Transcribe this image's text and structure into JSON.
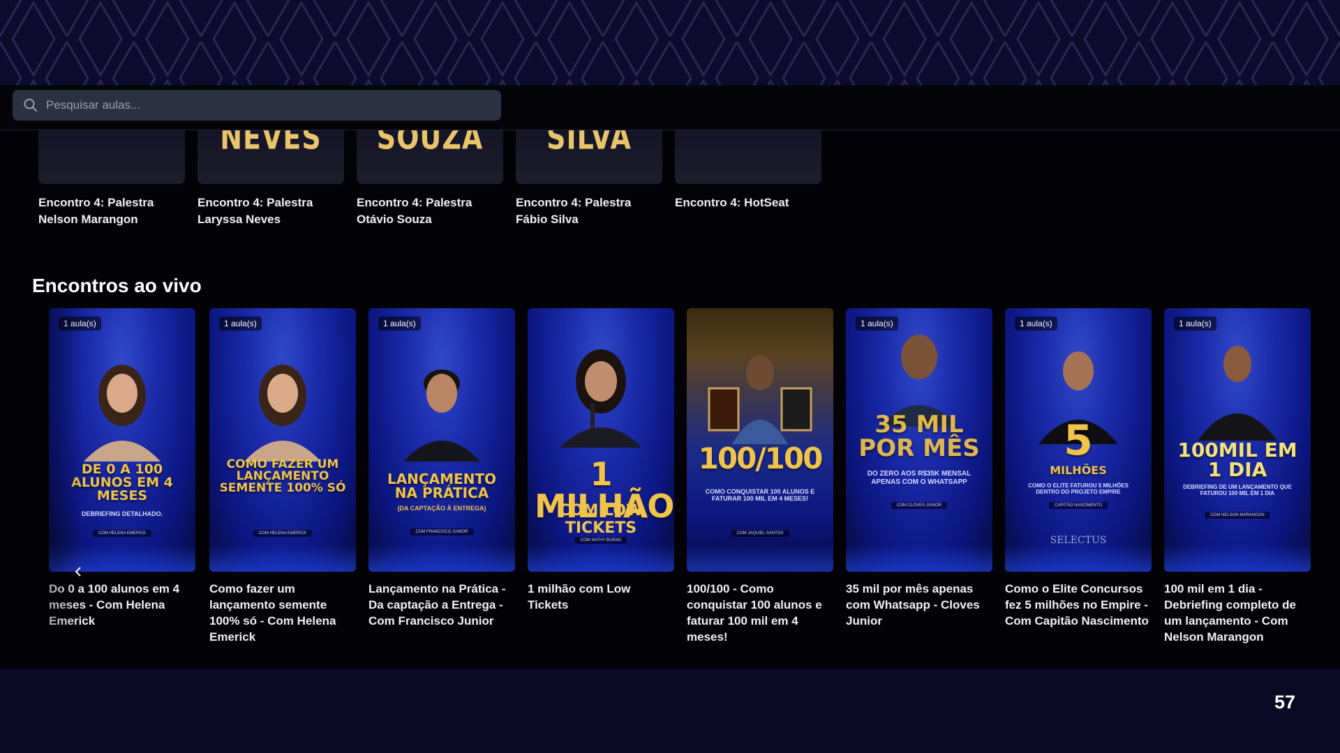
{
  "search": {
    "placeholder": "Pesquisar aulas..."
  },
  "previous_row": [
    {
      "thumb_text": "",
      "title": "Encontro 4: Palestra Nelson Marangon"
    },
    {
      "thumb_text": "NEVES",
      "title": "Encontro 4: Palestra Laryssa Neves"
    },
    {
      "thumb_text": "SOUZA",
      "title": "Encontro 4: Palestra Otávio Souza"
    },
    {
      "thumb_text": "SILVA",
      "title": "Encontro 4: Palestra Fábio Silva"
    },
    {
      "thumb_text": "",
      "title": "Encontro 4: HotSeat"
    }
  ],
  "section": {
    "title": "Encontros ao vivo"
  },
  "cards": [
    {
      "badge": "1 aula(s)",
      "headline": "DE 0 A 100 ALUNOS EM 4 MESES",
      "subline": "DEBRIEFING DETALHADO.",
      "byline": "COM HELENA EMERICK",
      "title": "Do 0 a 100 alunos em 4 meses - Com Helena Emerick"
    },
    {
      "badge": "1 aula(s)",
      "headline": "COMO FAZER UM LANÇAMENTO SEMENTE 100% SÓ",
      "subline": "",
      "byline": "COM HELENA EMERICK",
      "title": "Como fazer um lançamento semente 100% só - Com Helena Emerick"
    },
    {
      "badge": "1 aula(s)",
      "headline": "LANÇAMENTO NA PRÁTICA",
      "subline": "(DA CAPTAÇÃO À ENTREGA)",
      "byline": "COM FRANCISCO JUNIOR",
      "title": "Lançamento na Prática - Da captação a Entrega - Com Francisco Junior"
    },
    {
      "badge": "",
      "headline": "1 MILHÃO",
      "subline": "COM LOW TICKETS",
      "byline": "COM NATHY BUENO",
      "title": "1 milhão com Low Tickets"
    },
    {
      "badge": "",
      "headline": "100/100",
      "subline": "COMO CONQUISTAR 100 ALUNOS E FATURAR 100 MIL EM 4 MESES!",
      "byline": "COM JAQUIEL SANTOS",
      "title": "100/100 - Como conquistar 100 alunos e faturar 100 mil em 4 meses!"
    },
    {
      "badge": "1 aula(s)",
      "headline": "35 MIL POR MÊS",
      "subline": "DO ZERO AOS R$35K MENSAL APENAS COM O WHATSAPP",
      "byline": "COM CLOVES JUNIOR",
      "title": "35 mil por mês apenas com Whatsapp - Cloves Junior"
    },
    {
      "badge": "1 aula(s)",
      "headline": "5",
      "subline": "COMO O ELITE FATUROU 5 MILHÕES DENTRO DO PROJETO EMPIRE",
      "byline": "CAPITÃO NASCIMENTO",
      "extra": "MILHÕES",
      "brand": "SELECTUS",
      "title": "Como o Elite Concursos fez 5 milhões no Empire - Com Capitão Nascimento"
    },
    {
      "badge": "1 aula(s)",
      "headline": "100MIL EM 1 DIA",
      "subline": "DEBRIEFING DE UM LANÇAMENTO QUE FATUROU 100 MIL EM 1 DIA",
      "byline": "COM NELSON MARANGON",
      "title": "100 mil em 1 dia - Debriefing completo de um lançamento - Com Nelson Marangon"
    }
  ],
  "page_number": "57",
  "colors": {
    "accent_gold": "#f0c34a",
    "card_blue": "#1a2aa8",
    "background": "#020207",
    "slide_bg": "#0b0a24"
  }
}
